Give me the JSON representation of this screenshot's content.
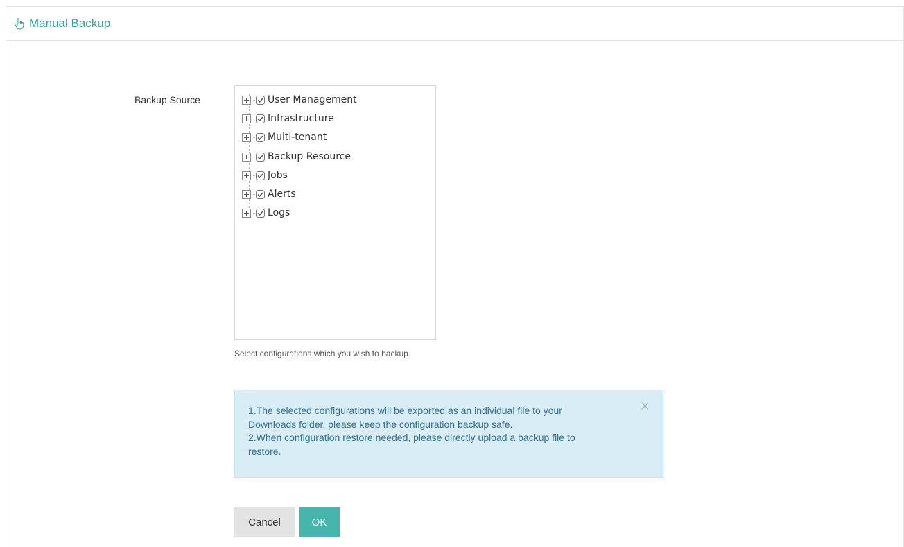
{
  "header": {
    "title": "Manual Backup",
    "icon": "hand-pointer-icon"
  },
  "form": {
    "label": "Backup Source",
    "tree": [
      {
        "label": "User Management",
        "checked": true,
        "expanded": false
      },
      {
        "label": "Infrastructure",
        "checked": true,
        "expanded": false
      },
      {
        "label": "Multi-tenant",
        "checked": true,
        "expanded": false
      },
      {
        "label": "Backup Resource",
        "checked": true,
        "expanded": false
      },
      {
        "label": "Jobs",
        "checked": true,
        "expanded": false
      },
      {
        "label": "Alerts",
        "checked": true,
        "expanded": false
      },
      {
        "label": "Logs",
        "checked": true,
        "expanded": false
      }
    ],
    "hint": "Select configurations which you wish to backup."
  },
  "alert": {
    "lines": [
      "1.The selected configurations will be exported as an individual file to your",
      "Downloads folder, please keep the configuration backup safe.",
      "2.When configuration restore needed, please directly upload a backup file to",
      "restore."
    ]
  },
  "buttons": {
    "cancel": "Cancel",
    "ok": "OK"
  },
  "colors": {
    "accent": "#2fa59a",
    "ok_button": "#46b5ab",
    "alert_bg": "#d9edf7",
    "alert_text": "#31708f"
  }
}
